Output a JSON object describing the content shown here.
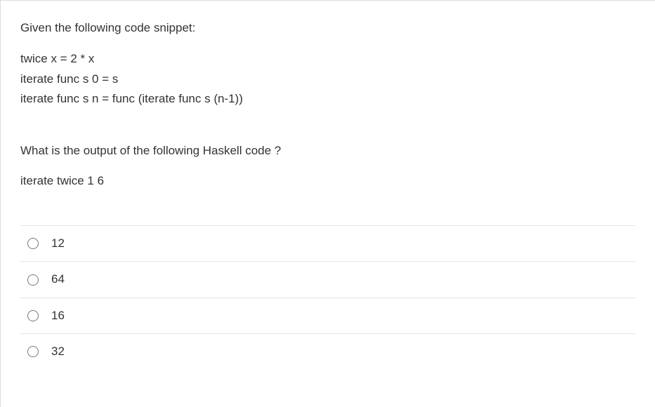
{
  "question": {
    "intro": "Given the following code snippet:",
    "code_lines": [
      "twice x  = 2 * x",
      "iterate func s 0 = s",
      "iterate func s n = func (iterate func s (n-1))"
    ],
    "prompt": "What  is the output of the following Haskell code ?",
    "call_line": "iterate twice 1 6"
  },
  "options": [
    {
      "label": "12"
    },
    {
      "label": "64"
    },
    {
      "label": "16"
    },
    {
      "label": "32"
    }
  ]
}
